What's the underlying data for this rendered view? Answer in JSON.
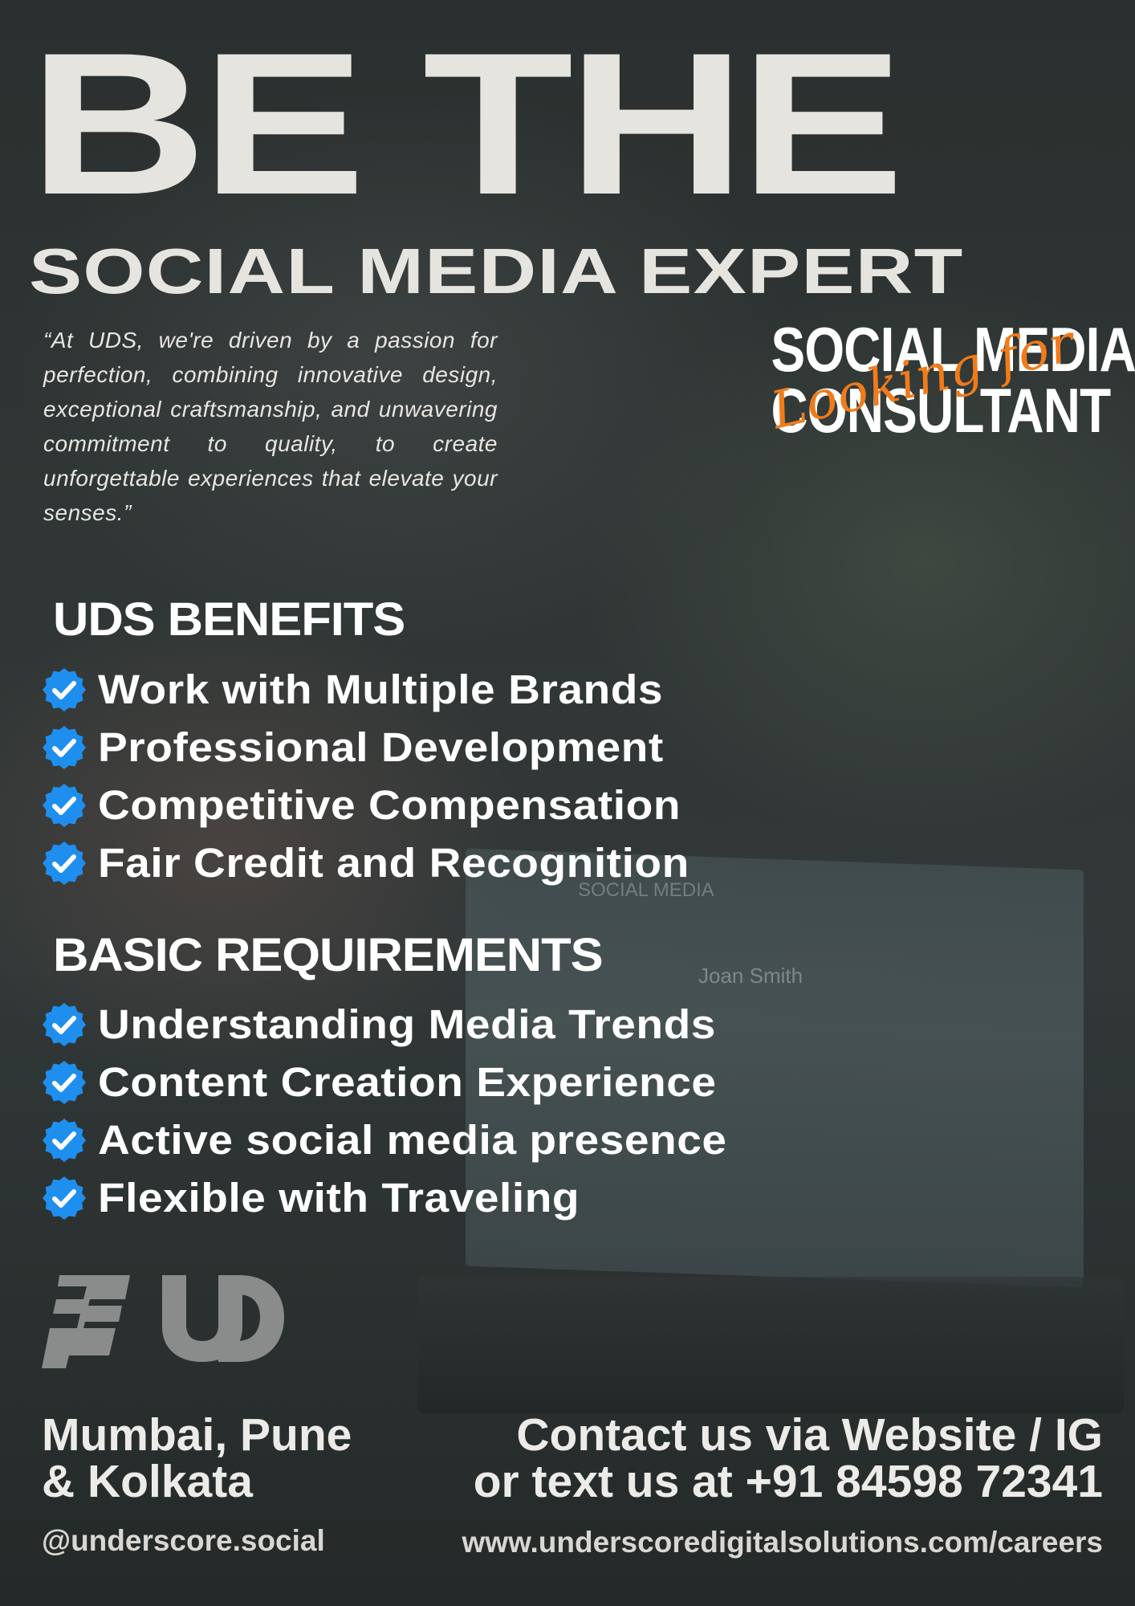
{
  "headline": "BE THE",
  "subheadline": "SOCIAL MEDIA EXPERT",
  "quote": "“At UDS, we're driven by a passion for perfection, combining innovative design, exceptional craftsmanship, and unwavering commitment to quality, to create unforgettable experiences that elevate your senses.”",
  "role": {
    "script_text": "Looking for",
    "line1": "SOCIAL MEDIA",
    "line2": "CONSULTANT",
    "script_color": "#f07b1b"
  },
  "benefits": {
    "title": "UDS BENEFITS",
    "items": [
      "Work with Multiple Brands",
      "Professional Development",
      "Competitive Compensation",
      "Fair Credit and Recognition"
    ]
  },
  "requirements": {
    "title": "BASIC REQUIREMENTS",
    "items": [
      "Understanding Media Trends",
      "Content Creation Experience",
      "Active social media presence",
      "Flexible with Traveling"
    ]
  },
  "background_screen": {
    "label": "SOCIAL MEDIA",
    "name": "Joan Smith"
  },
  "footer": {
    "location_line1": "Mumbai, Pune",
    "location_line2": "& Kolkata",
    "contact_line1": "Contact us via Website / IG",
    "contact_line2": "or text us at +91 84598 72341",
    "handle": "@underscore.social",
    "website": "www.underscoredigitalsolutions.com/careers"
  },
  "colors": {
    "check_badge": "#1f8fef",
    "headline_text": "#e6e4df",
    "logo_gray": "#8a8c8c"
  },
  "icons": {
    "check": "verified-check-badge-icon",
    "logo": "uds-logo"
  }
}
